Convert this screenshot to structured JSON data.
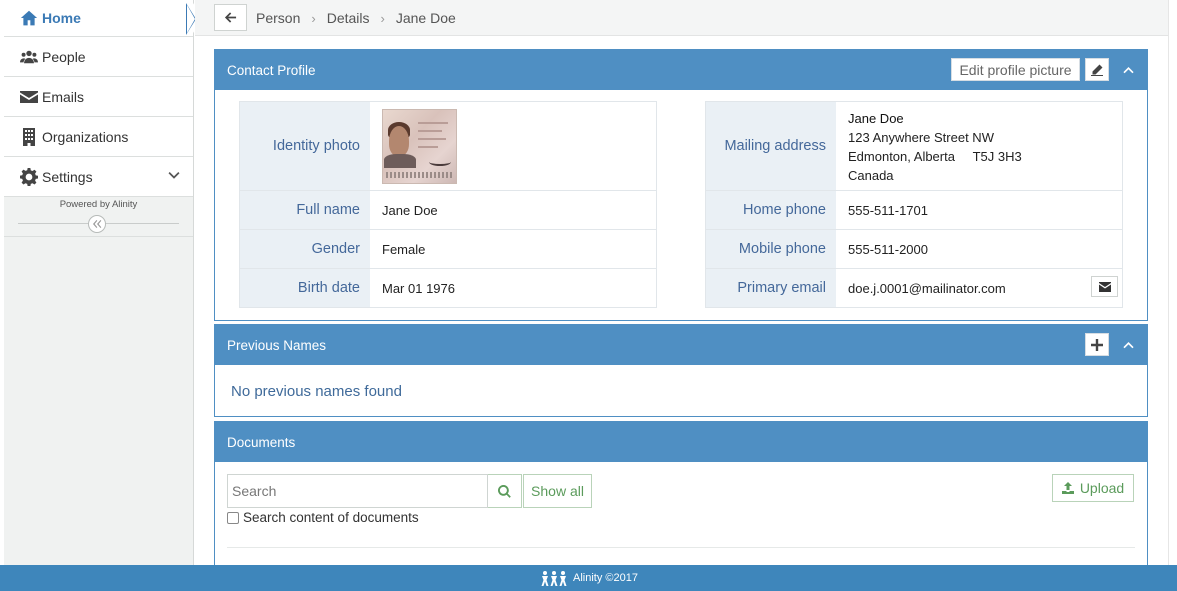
{
  "sidebar": {
    "items": [
      {
        "label": "Home",
        "icon": "home-icon"
      },
      {
        "label": "People",
        "icon": "users-icon"
      },
      {
        "label": "Emails",
        "icon": "envelope-icon"
      },
      {
        "label": "Organizations",
        "icon": "building-icon"
      },
      {
        "label": "Settings",
        "icon": "gear-icon"
      }
    ],
    "powered_by": "Powered by Alinity"
  },
  "breadcrumb": [
    "Person",
    "Details",
    "Jane Doe"
  ],
  "contact_profile": {
    "title": "Contact Profile",
    "edit_picture_label": "Edit profile picture",
    "left": {
      "identity_photo_label": "Identity photo",
      "full_name_label": "Full name",
      "full_name": "Jane Doe",
      "gender_label": "Gender",
      "gender": "Female",
      "birth_date_label": "Birth date",
      "birth_date": "Mar 01 1976"
    },
    "right": {
      "mailing_address_label": "Mailing address",
      "address_name": "Jane Doe",
      "address_line1": "123 Anywhere Street NW",
      "address_city": "Edmonton, Alberta",
      "address_postal": "T5J 3H3",
      "address_country": "Canada",
      "home_phone_label": "Home phone",
      "home_phone": "555-511-1701",
      "mobile_phone_label": "Mobile phone",
      "mobile_phone": "555-511-2000",
      "primary_email_label": "Primary email",
      "primary_email": "doe.j.0001@mailinator.com"
    }
  },
  "previous_names": {
    "title": "Previous Names",
    "empty_message": "No previous names found"
  },
  "documents": {
    "title": "Documents",
    "search_placeholder": "Search",
    "show_all_label": "Show all",
    "search_content_label": "Search content of documents",
    "upload_label": "Upload"
  },
  "footer": {
    "text": "Alinity ©2017"
  },
  "colors": {
    "accent": "#4f8fc3",
    "footer": "#3e86bb",
    "label_text": "#44689a",
    "success": "#5b9b5b"
  }
}
